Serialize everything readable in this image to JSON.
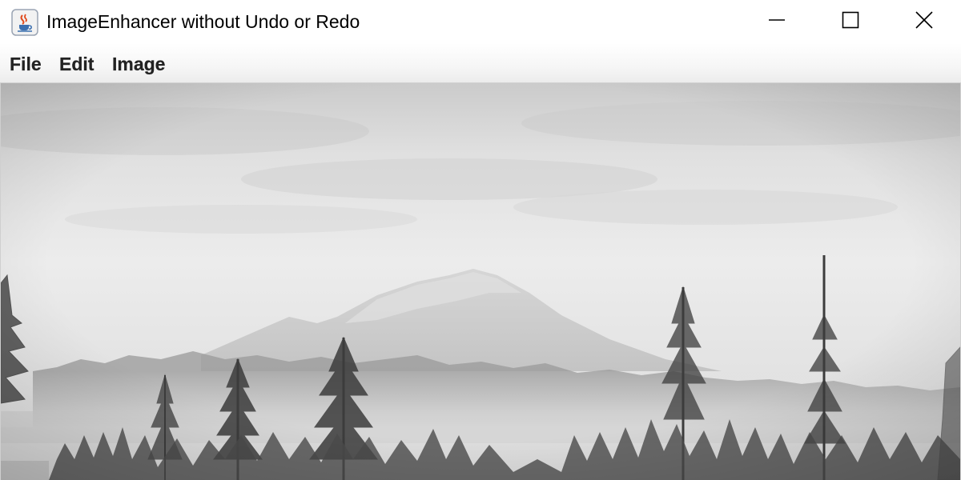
{
  "window": {
    "title": "ImageEnhancer without Undo or Redo",
    "icon": "java-coffee-cup-icon",
    "controls": {
      "minimize_icon": "minimize-icon",
      "maximize_icon": "maximize-icon",
      "close_icon": "close-icon"
    }
  },
  "menu": {
    "file_label": "File",
    "edit_label": "Edit",
    "image_label": "Image"
  },
  "canvas": {
    "content": "grayscale-photo",
    "colors": {
      "sky_top": "#c9c9c9",
      "sky_mid": "#e9e9e9",
      "mountain": "#cfcfcf",
      "trees_dark": "#3a3a3a"
    }
  }
}
